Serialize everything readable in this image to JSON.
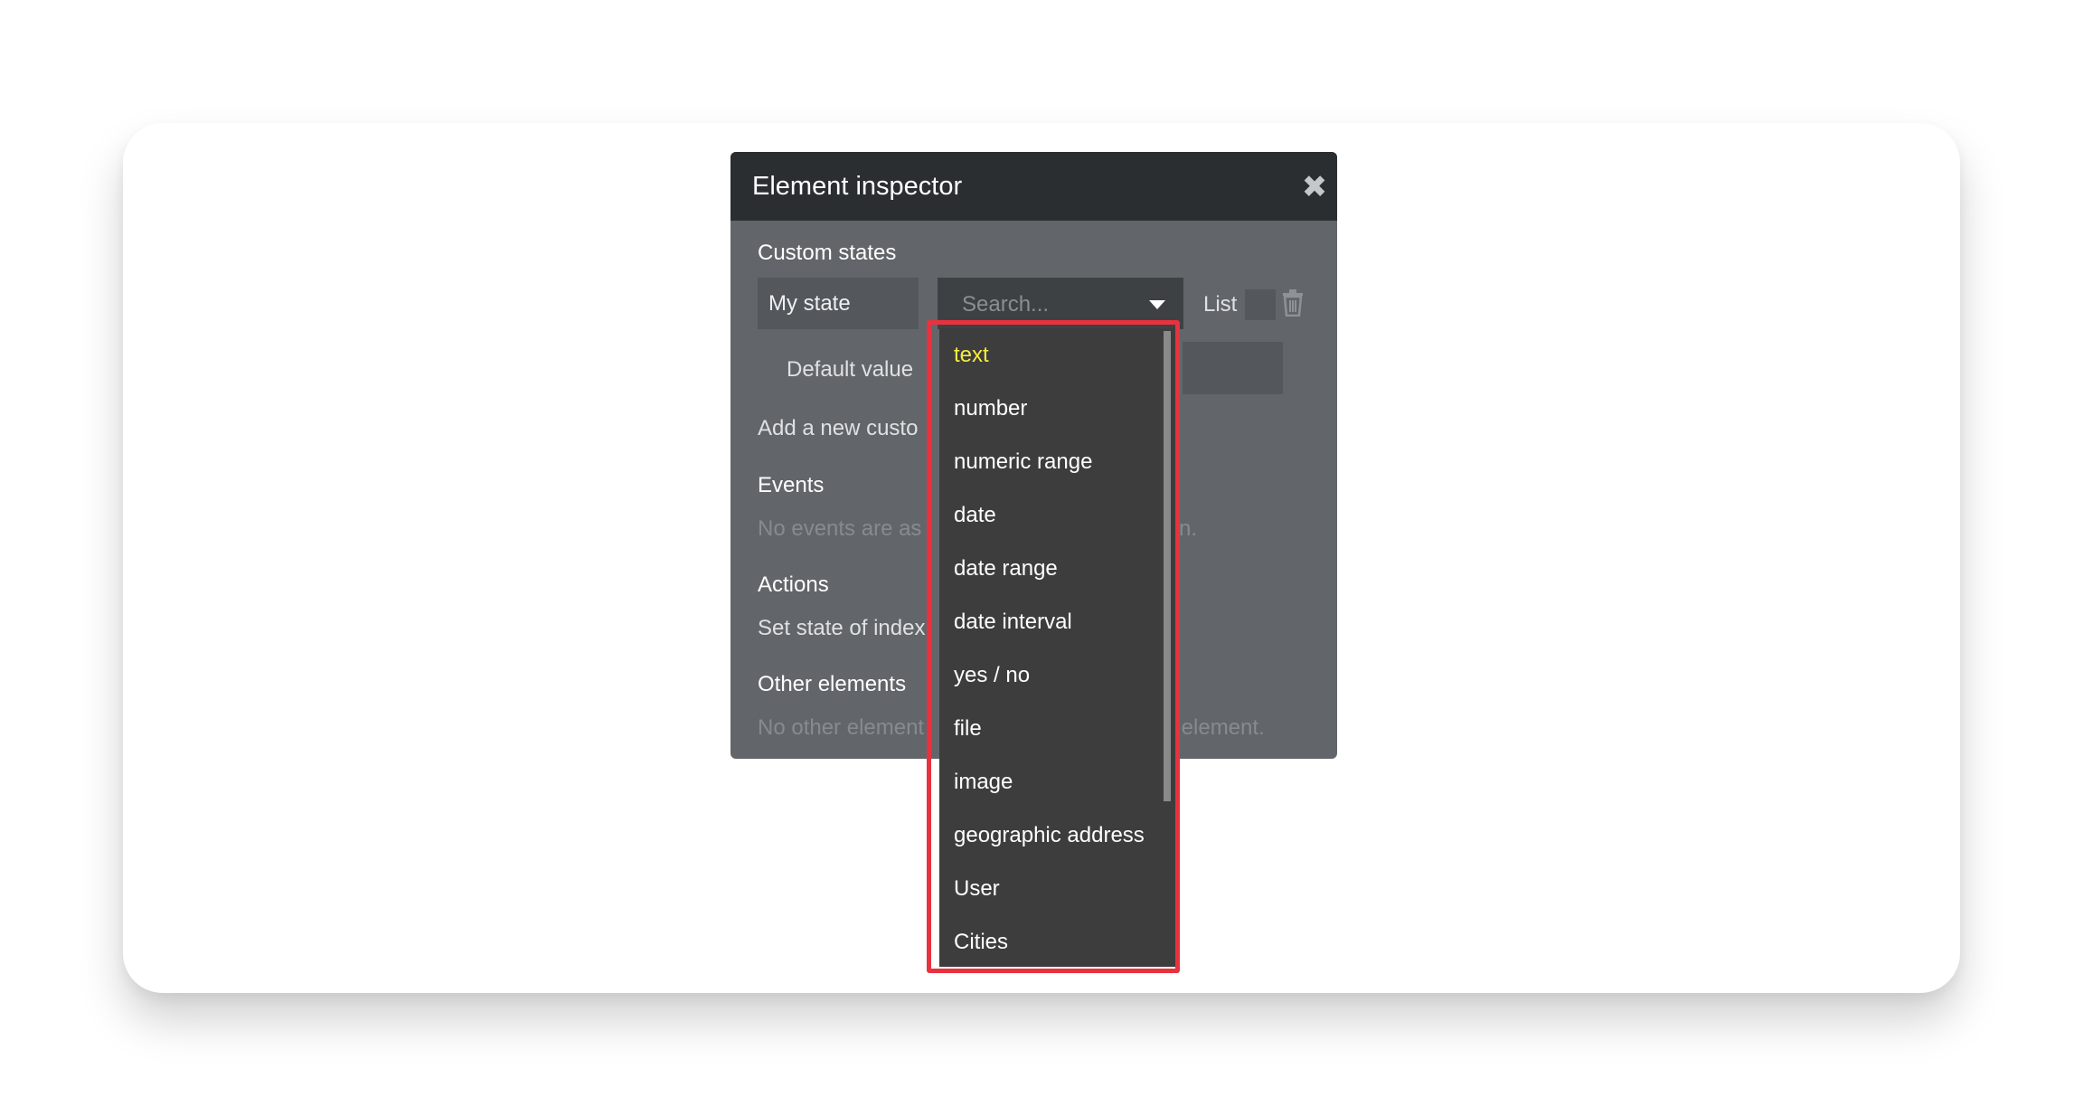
{
  "inspector": {
    "title": "Element inspector",
    "custom_states_label": "Custom states",
    "state_name": "My state",
    "type_select": {
      "placeholder": "Search..."
    },
    "list_label": "List",
    "default_value_label": "Default value",
    "add_new_custom_partial": "Add a new custo",
    "events_label": "Events",
    "events_empty_partial": "No events are as",
    "events_empty_tail": "n.",
    "actions_label": "Actions",
    "actions_partial": "Set state of index",
    "other_elements_label": "Other elements",
    "other_empty_partial": "No other element",
    "other_empty_tail": "s element."
  },
  "dropdown": {
    "items": [
      "text",
      "number",
      "numeric range",
      "date",
      "date range",
      "date interval",
      "yes / no",
      "file",
      "image",
      "geographic address",
      "User",
      "Cities"
    ],
    "selected_index": 0
  },
  "colors": {
    "highlight": "#e8323e",
    "selected_item": "#f4ed3c",
    "header": "#2b2e31",
    "panel": "#62666a"
  }
}
